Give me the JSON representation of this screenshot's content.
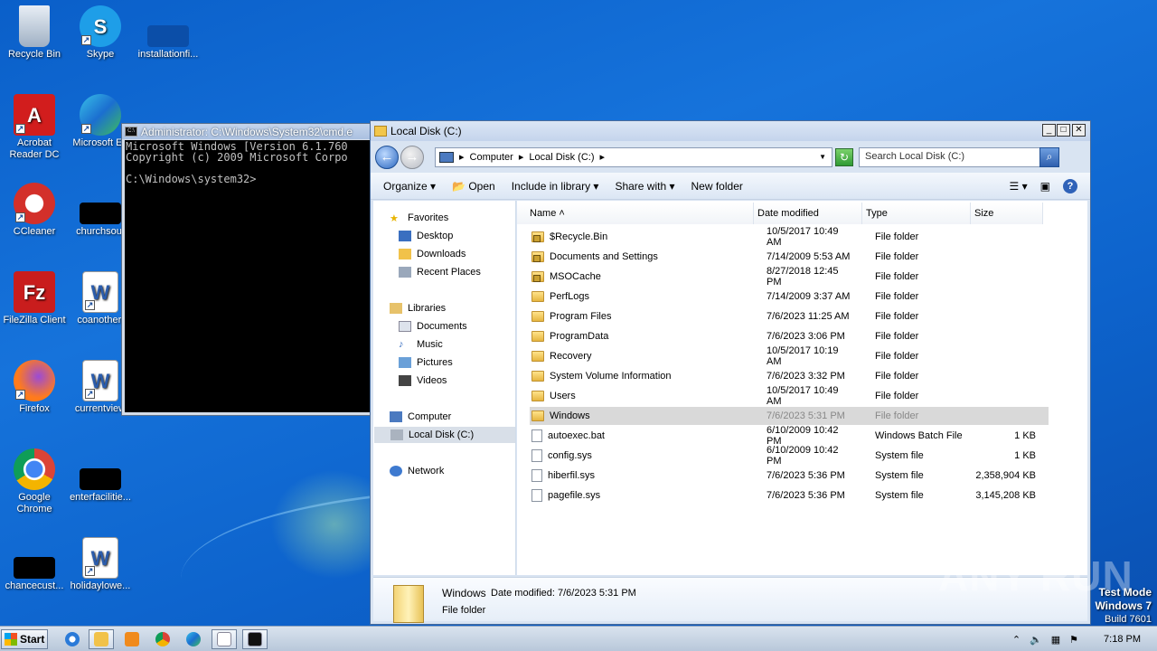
{
  "desktop": {
    "icons": [
      {
        "label": "Recycle Bin",
        "icon": "recycle-bin-icon"
      },
      {
        "label": "Skype",
        "icon": "skype-icon"
      },
      {
        "label": "installationfi...",
        "icon": "file-icon"
      },
      {
        "label": "Acrobat Reader DC",
        "icon": "acrobat-icon"
      },
      {
        "label": "Microsoft Ed",
        "icon": "edge-icon"
      },
      {
        "label": "CCleaner",
        "icon": "ccleaner-icon"
      },
      {
        "label": "churchsout",
        "icon": "file-icon"
      },
      {
        "label": "FileZilla Client",
        "icon": "filezilla-icon"
      },
      {
        "label": "coanother.",
        "icon": "word-doc-icon"
      },
      {
        "label": "Firefox",
        "icon": "firefox-icon"
      },
      {
        "label": "currentview",
        "icon": "word-doc-icon"
      },
      {
        "label": "Google Chrome",
        "icon": "chrome-icon"
      },
      {
        "label": "enterfacilitie...",
        "icon": "file-icon"
      },
      {
        "label": "chancecust...",
        "icon": "file-icon"
      },
      {
        "label": "holidaylowe...",
        "icon": "word-doc-icon"
      }
    ]
  },
  "cmd": {
    "title": "Administrator: C:\\Windows\\System32\\cmd.e",
    "content": "Microsoft Windows [Version 6.1.760\nCopyright (c) 2009 Microsoft Corpo\n\nC:\\Windows\\system32>"
  },
  "explorer": {
    "title": "Local Disk (C:)",
    "address": {
      "computer": "Computer",
      "drive": "Local Disk (C:)"
    },
    "search_placeholder": "Search Local Disk (C:)",
    "toolbar": {
      "organize": "Organize",
      "open": "Open",
      "include": "Include in library",
      "share": "Share with",
      "new_folder": "New folder"
    },
    "nav": {
      "favorites": "Favorites",
      "desktop": "Desktop",
      "downloads": "Downloads",
      "recent": "Recent Places",
      "libraries": "Libraries",
      "documents": "Documents",
      "music": "Music",
      "pictures": "Pictures",
      "videos": "Videos",
      "computer": "Computer",
      "local_disk": "Local Disk (C:)",
      "network": "Network"
    },
    "columns": {
      "name": "Name",
      "date": "Date modified",
      "type": "Type",
      "size": "Size"
    },
    "files": [
      {
        "name": "$Recycle.Bin",
        "date": "10/5/2017 10:49 AM",
        "type": "File folder",
        "size": "",
        "kind": "lockfolder"
      },
      {
        "name": "Documents and Settings",
        "date": "7/14/2009 5:53 AM",
        "type": "File folder",
        "size": "",
        "kind": "lockfolder"
      },
      {
        "name": "MSOCache",
        "date": "8/27/2018 12:45 PM",
        "type": "File folder",
        "size": "",
        "kind": "lockfolder"
      },
      {
        "name": "PerfLogs",
        "date": "7/14/2009 3:37 AM",
        "type": "File folder",
        "size": "",
        "kind": "folder"
      },
      {
        "name": "Program Files",
        "date": "7/6/2023 11:25 AM",
        "type": "File folder",
        "size": "",
        "kind": "folder"
      },
      {
        "name": "ProgramData",
        "date": "7/6/2023 3:06 PM",
        "type": "File folder",
        "size": "",
        "kind": "folder"
      },
      {
        "name": "Recovery",
        "date": "10/5/2017 10:19 AM",
        "type": "File folder",
        "size": "",
        "kind": "folder"
      },
      {
        "name": "System Volume Information",
        "date": "7/6/2023 3:32 PM",
        "type": "File folder",
        "size": "",
        "kind": "folder"
      },
      {
        "name": "Users",
        "date": "10/5/2017 10:49 AM",
        "type": "File folder",
        "size": "",
        "kind": "folder"
      },
      {
        "name": "Windows",
        "date": "7/6/2023 5:31 PM",
        "type": "File folder",
        "size": "",
        "kind": "folder",
        "selected": true
      },
      {
        "name": "autoexec.bat",
        "date": "6/10/2009 10:42 PM",
        "type": "Windows Batch File",
        "size": "1 KB",
        "kind": "file"
      },
      {
        "name": "config.sys",
        "date": "6/10/2009 10:42 PM",
        "type": "System file",
        "size": "1 KB",
        "kind": "file"
      },
      {
        "name": "hiberfil.sys",
        "date": "7/6/2023 5:36 PM",
        "type": "System file",
        "size": "2,358,904 KB",
        "kind": "file"
      },
      {
        "name": "pagefile.sys",
        "date": "7/6/2023 5:36 PM",
        "type": "System file",
        "size": "3,145,208 KB",
        "kind": "file"
      }
    ],
    "details": {
      "name": "Windows",
      "modified_label": "Date modified:",
      "modified": "7/6/2023 5:31 PM",
      "type": "File folder"
    }
  },
  "watermark": "ANY RUN",
  "testmode": {
    "line1": "Test Mode",
    "line2": "Windows 7",
    "line3": "Build 7601"
  },
  "taskbar": {
    "start": "Start",
    "clock": "7:18 PM"
  }
}
